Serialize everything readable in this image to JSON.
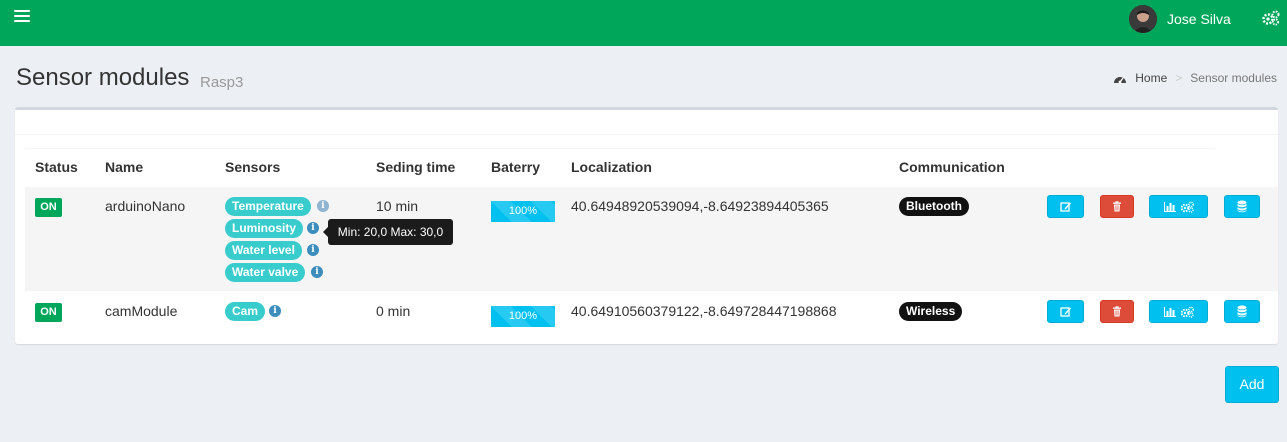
{
  "header": {
    "user_name": "Jose Silva",
    "menu_icon": "hamburger-icon",
    "settings_icon": "cogs-icon",
    "brand_color": "#00a65a"
  },
  "page": {
    "title": "Sensor modules",
    "subtitle": "Rasp3"
  },
  "breadcrumb": {
    "home": "Home",
    "current": "Sensor modules"
  },
  "table": {
    "headers": [
      "Status",
      "Name",
      "Sensors",
      "Seding time",
      "Baterry",
      "Localization",
      "Communication"
    ],
    "rows": [
      {
        "status": "ON",
        "name": "arduinoNano",
        "sensors": [
          "Temperature",
          "Luminosity",
          "Water level",
          "Water valve"
        ],
        "sending_time": "10 min",
        "battery": "100%",
        "battery_level": 100,
        "localization": "40.64948920539094,-8.64923894405365",
        "communication": "Bluetooth"
      },
      {
        "status": "ON",
        "name": "camModule",
        "sensors": [
          "Cam"
        ],
        "sending_time": "0 min",
        "battery": "100%",
        "battery_level": 100,
        "localization": "40.64910560379122,-8.649728447198868",
        "communication": "Wireless"
      }
    ]
  },
  "tooltip": "Min: 20,0 Max: 30,0",
  "actions": {
    "add_label": "Add"
  },
  "colors": {
    "success": "#00a65a",
    "info": "#00c0ef",
    "danger": "#dd4b39",
    "teal": "#39cccc"
  }
}
